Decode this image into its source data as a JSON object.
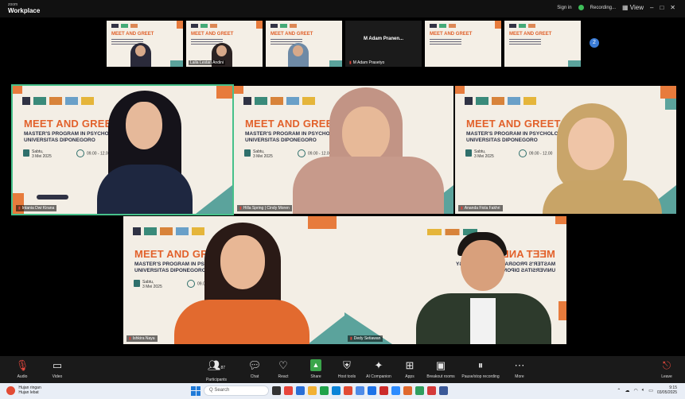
{
  "app": {
    "brand_meta": "zoom",
    "brand_name": "Workplace"
  },
  "topbar": {
    "signin": "Sign in",
    "recording": "Recording...",
    "view_icon": "grid-view-icon",
    "window_icons": [
      "minimize-icon",
      "maximize-icon",
      "close-icon"
    ]
  },
  "gallery": {
    "thumbs": [
      {
        "name": ""
      },
      {
        "name": "Laila Lestari Andini"
      },
      {
        "name": ""
      },
      {
        "name": "M Adam Prasetyo",
        "label": "M Adam Pranen...",
        "muted": true
      },
      {
        "name": ""
      },
      {
        "name": ""
      }
    ],
    "page_indicator": "2"
  },
  "slide": {
    "title": "MEET AND GREET",
    "subtitle_1": "MASTER'S PROGRAM IN PSYCHOLOGY",
    "subtitle_2": "UNIVERSITAS DIPONEGORO",
    "date_1": "Sabtu,",
    "date_2": "3 Mei 2025",
    "time": "09.00 - 12.00"
  },
  "participants": [
    {
      "name": "Intania Dwi Kirana",
      "muted": true
    },
    {
      "name": "Hilla Spring | Cindy Moren",
      "muted": true
    },
    {
      "name": "Ananda Fiola Fakhri",
      "muted": true
    },
    {
      "name": "Ishkira Naya",
      "muted": true
    },
    {
      "name": "Dedy Setiawan",
      "muted": true
    }
  ],
  "toolbar": {
    "audio": "Audio",
    "video": "Video",
    "participants": "Participants",
    "participants_count": "87",
    "chat": "Chat",
    "react": "React",
    "share": "Share",
    "host_tools": "Host tools",
    "ai_companion": "AI Companion",
    "apps": "Apps",
    "breakout": "Breakout rooms",
    "record": "Pause/stop recording",
    "more": "More",
    "leave": "Leave"
  },
  "taskbar": {
    "weather_1": "Hujan ringan",
    "weather_2": "Hujan lebat",
    "search": "Q Search",
    "time": "9:15",
    "date": "03/05/2025"
  },
  "colors": {
    "accent_orange": "#e2612b",
    "accent_teal": "#5ba39c",
    "active_speaker": "#46c08a",
    "mute_red": "#e0443a"
  }
}
